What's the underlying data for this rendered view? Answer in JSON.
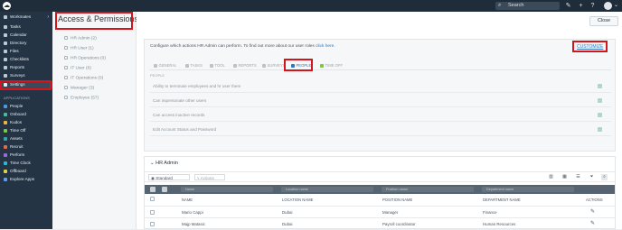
{
  "topbar": {
    "search_label": "Search",
    "icons": [
      "cloud-icon",
      "search-icon",
      "pen-icon",
      "plus-icon",
      "help-icon",
      "avatar-icon",
      "chevron-down-icon"
    ]
  },
  "sidebar": {
    "company": "Workmates",
    "main_items": [
      "Tasks",
      "Calendar",
      "Directory",
      "Files",
      "Checklists",
      "Reports",
      "Surveys",
      "Settings"
    ],
    "section_label": "APPLICATIONS",
    "app_items": [
      "People",
      "Onboard",
      "Kudos",
      "Time Off",
      "Assets",
      "Recruit",
      "Perform",
      "Time Clock",
      "Offboard",
      "Explore Apps"
    ]
  },
  "subnav": {
    "title": "Access & Permissions",
    "items": [
      "HR Admin (2)",
      "HR User (1)",
      "HR Operations (0)",
      "IT User (0)",
      "IT Operations (0)",
      "Manager (3)",
      "Employee (57)"
    ]
  },
  "content": {
    "close_label": "Close",
    "intro": "Configure which actions HR Admin can perform. To find out more about our user roles",
    "intro_link": "click here.",
    "customize_label": "CUSTOMIZE",
    "tabs": [
      "GENERAL",
      "TASKS",
      "TOOL",
      "REPORTS",
      "SURVEYS",
      "PEOPLE",
      "TIME OFF"
    ],
    "section_label": "PEOPLE",
    "permissions": [
      "Ability to terminate employees and hr user them",
      "Can impersonate other users",
      "Can access inactive records",
      "Edit Account Status and Password"
    ],
    "admin_heading": "HR Admin",
    "view_select": "Standard",
    "actions_select": "Actions",
    "filter_placeholders": [
      "Name",
      "Location name",
      "Position name",
      "Department name"
    ],
    "columns": [
      "NAME",
      "LOCATION NAME",
      "POSITION NAME",
      "DEPARTMENT NAME",
      "ACTIONS"
    ],
    "rows": [
      {
        "name": "Mario Cappi",
        "location": "Dubai",
        "position": "Manager",
        "department": "Finance"
      },
      {
        "name": "Majp Matasic",
        "location": "Dubai",
        "position": "Payroll coordinator",
        "department": "Human Resources"
      }
    ]
  },
  "colors": {
    "accent": "#2a79bf",
    "sidebar": "#243444",
    "highlight": "#d6141c",
    "checkbox": "#a7d8d4"
  }
}
